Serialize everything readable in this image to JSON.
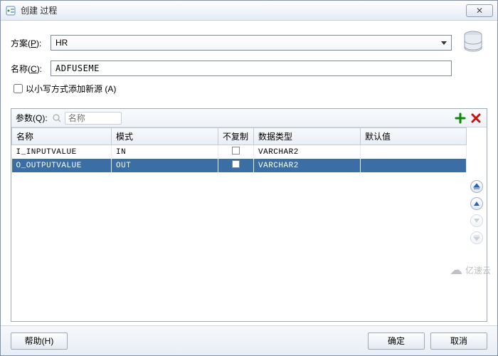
{
  "dialog": {
    "title": "创建 过程",
    "close": "✕"
  },
  "form": {
    "scheme_label": "方案",
    "scheme_mn": "P",
    "scheme_value": "HR",
    "name_label": "名称",
    "name_mn": "C",
    "name_value": "ADFUSEME",
    "lowercase_label": "以小写方式添加新源 ",
    "lowercase_mn": "A"
  },
  "params": {
    "label": "参数",
    "mn": "Q",
    "search_placeholder": "名称",
    "headers": {
      "name": "名称",
      "mode": "模式",
      "nocopy": "不复制",
      "dtype": "数据类型",
      "default": "默认值"
    },
    "rows": [
      {
        "name": "I_INPUTVALUE",
        "mode": "IN",
        "nocopy": false,
        "dtype": "VARCHAR2",
        "default": "",
        "selected": false
      },
      {
        "name": "O_OUTPUTVALUE",
        "mode": "OUT",
        "nocopy": false,
        "dtype": "VARCHAR2",
        "default": "",
        "selected": true
      }
    ]
  },
  "footer": {
    "help": "帮助(H)",
    "ok": "确定",
    "cancel": "取消"
  },
  "watermark": "亿速云"
}
